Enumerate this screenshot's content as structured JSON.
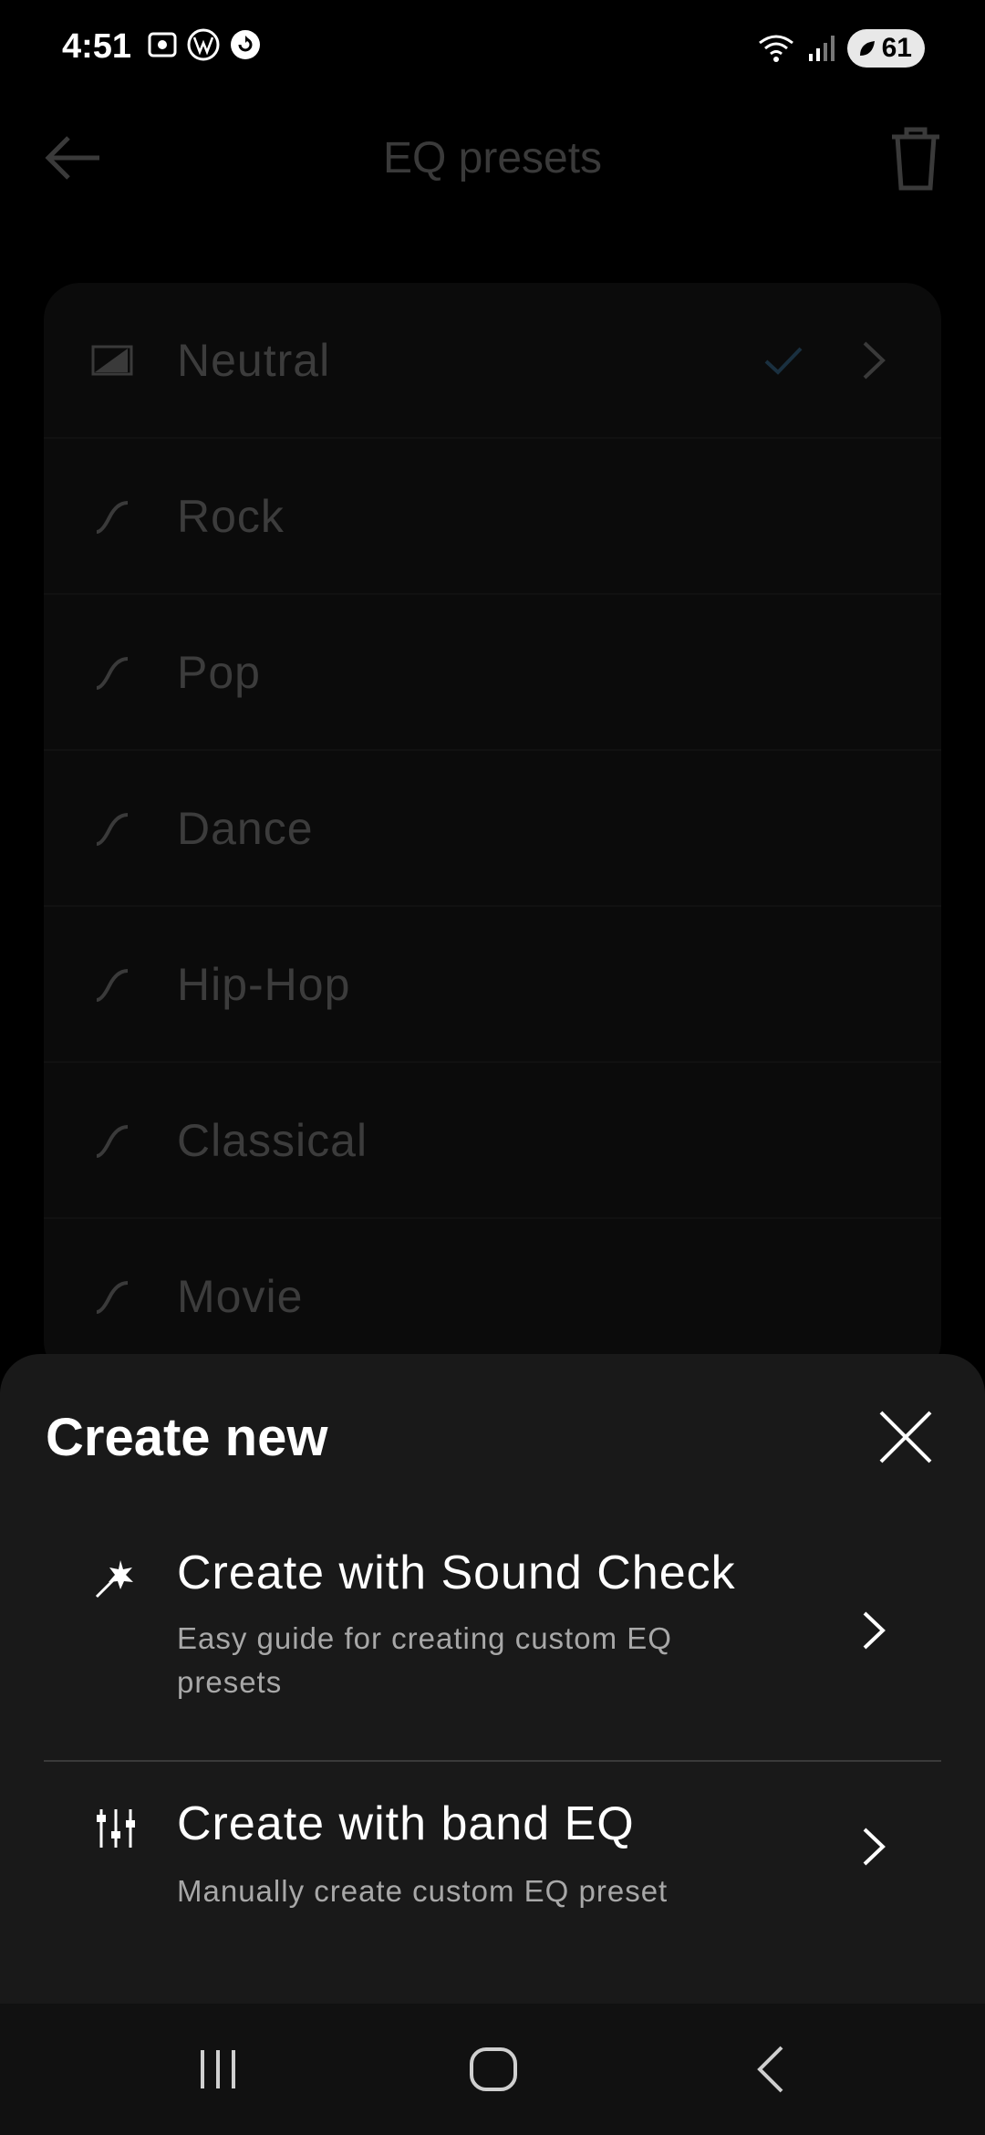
{
  "status_bar": {
    "time": "4:51",
    "left_icons": [
      "screen-record-icon",
      "vw-logo-icon",
      "app-notification-icon"
    ],
    "right_icons": [
      "wifi-icon",
      "signal-icon",
      "battery-icon"
    ],
    "battery": "61"
  },
  "header": {
    "title": "EQ presets",
    "back_icon": "back-arrow-icon",
    "delete_icon": "trash-icon"
  },
  "presets": [
    {
      "label": "Neutral",
      "icon": "neutral-eq-icon",
      "selected": true
    },
    {
      "label": "Rock",
      "icon": "eq-curve-icon",
      "selected": false
    },
    {
      "label": "Pop",
      "icon": "eq-curve-icon",
      "selected": false
    },
    {
      "label": "Dance",
      "icon": "eq-curve-icon",
      "selected": false
    },
    {
      "label": "Hip-Hop",
      "icon": "eq-curve-icon",
      "selected": false
    },
    {
      "label": "Classical",
      "icon": "eq-curve-icon",
      "selected": false
    },
    {
      "label": "Movie",
      "icon": "eq-curve-icon",
      "selected": false
    }
  ],
  "sheet": {
    "title": "Create new",
    "close_icon": "close-icon",
    "options": [
      {
        "title": "Create with Sound Check",
        "subtitle": "Easy guide for creating custom EQ presets",
        "icon": "magic-wand-icon"
      },
      {
        "title": "Create with band EQ",
        "subtitle": "Manually create custom EQ preset",
        "icon": "sliders-icon"
      }
    ]
  },
  "nav": {
    "recents_icon": "recents-icon",
    "home_icon": "home-icon",
    "back_icon": "nav-back-icon"
  },
  "colors": {
    "background": "#000000",
    "sheet": "#191919",
    "dim_text": "#3c3c3c",
    "accent_check": "#1a3040"
  }
}
